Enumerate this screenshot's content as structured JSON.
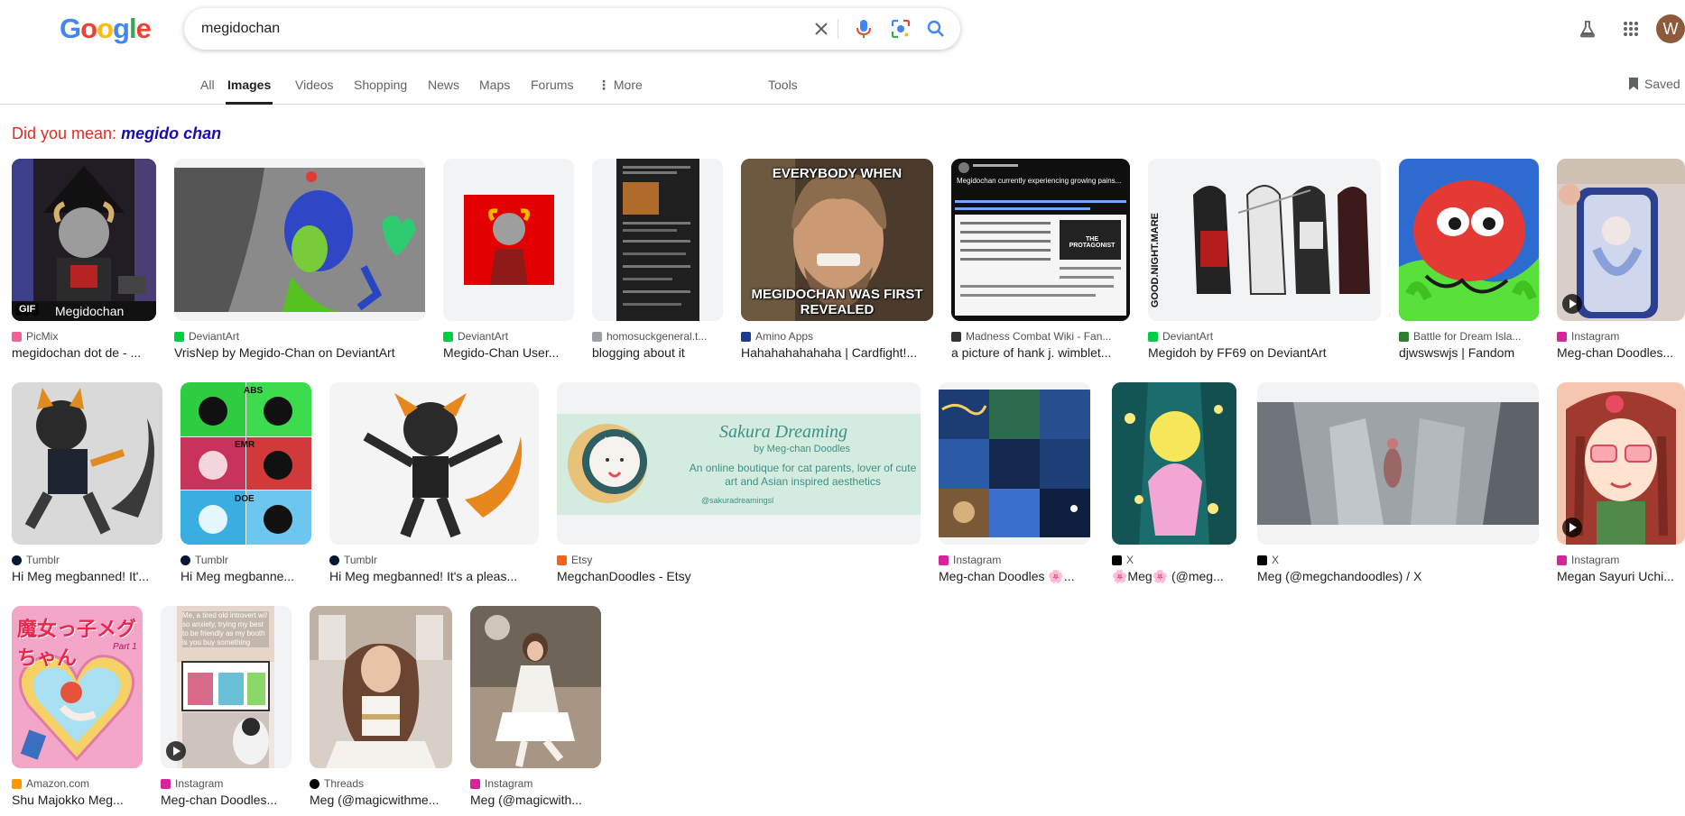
{
  "search": {
    "value": "megidochan"
  },
  "tabs": [
    {
      "label": "All"
    },
    {
      "label": "Images"
    },
    {
      "label": "Videos"
    },
    {
      "label": "Shopping"
    },
    {
      "label": "News"
    },
    {
      "label": "Maps"
    },
    {
      "label": "Forums"
    },
    {
      "label": "More"
    },
    {
      "label": "Tools"
    }
  ],
  "saved_label": "Saved",
  "avatar_letter": "W",
  "did_you_mean": {
    "prefix": "Did you mean:",
    "suggestion": "megido chan"
  },
  "results": [
    {
      "source": "PicMix",
      "title": "megidochan dot de - ...",
      "badge": "GIF",
      "caption": "Megidochan"
    },
    {
      "source": "DeviantArt",
      "title": "VrisNep by Megido-Chan on DeviantArt"
    },
    {
      "source": "DeviantArt",
      "title": "Megido-Chan User..."
    },
    {
      "source": "homosuckgeneral.t...",
      "title": "blogging about it"
    },
    {
      "source": "Amino Apps",
      "title": "Hahahahahahaha | Cardfight!...",
      "meme_top": "EVERYBODY WHEN",
      "meme_bottom": "MEGIDOCHAN WAS FIRST REVEALED"
    },
    {
      "source": "Madness Combat Wiki - Fan...",
      "title": "a picture of hank j. wimblet...",
      "tweet": "Megidochan currently experiencing growing pains...",
      "caption": "THE PROTAGONIST"
    },
    {
      "source": "DeviantArt",
      "title": "Megidoh by FF69 on DeviantArt",
      "caption": "GOOD.NIGHT.MARE"
    },
    {
      "source": "Battle for Dream Isla...",
      "title": "djwswswjs | Fandom"
    },
    {
      "source": "Instagram",
      "title": "Meg-chan Doodles..."
    },
    {
      "source": "Tumblr",
      "title": "Hi Meg megbanned! It'..."
    },
    {
      "source": "Tumblr",
      "title": "Hi Meg megbanne...",
      "labels": [
        "ABS",
        "EMR",
        "DOE"
      ]
    },
    {
      "source": "Tumblr",
      "title": "Hi Meg megbanned! It's a pleas..."
    },
    {
      "source": "Etsy",
      "title": "MegchanDoodles - Etsy",
      "banner_title": "Sakura Dreaming",
      "banner_by": "by Meg-chan Doodles",
      "banner_text": "An online boutique for cat parents, lover of cute art and Asian inspired aesthetics",
      "banner_handle": "@sakuradreamingsl"
    },
    {
      "source": "Instagram",
      "title": "Meg-chan Doodles 🌸..."
    },
    {
      "source": "X",
      "title": "🌸Meg🌸 (@meg..."
    },
    {
      "source": "X",
      "title": "Meg (@megchandoodles) / X"
    },
    {
      "source": "Instagram",
      "title": "Megan Sayuri Uchi..."
    },
    {
      "source": "Amazon.com",
      "title": "Shu Majokko Meg...",
      "jp": "魔女っ子メグちゃん",
      "part": "Part 1"
    },
    {
      "source": "Instagram",
      "title": "Meg-chan Doodles..."
    },
    {
      "source": "Threads",
      "title": "Meg (@magicwithme..."
    },
    {
      "source": "Instagram",
      "title": "Meg (@magicwith..."
    }
  ]
}
